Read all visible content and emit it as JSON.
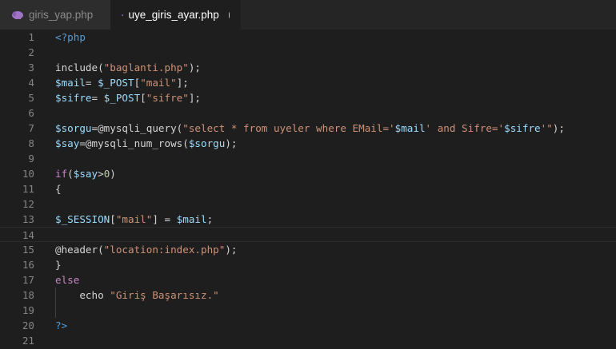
{
  "tabs": [
    {
      "label": "giris_yap.php",
      "icon": "php-elephant-icon",
      "active": false
    },
    {
      "label": "uye_giris_ayar.php",
      "icon": "php-elephant-icon",
      "active": true,
      "dirty": true
    }
  ],
  "colors": {
    "background": "#1e1e1e",
    "tab_bar": "#252526",
    "string": "#ce9178",
    "keyword": "#c586c0",
    "variable": "#9cdcfe",
    "tag": "#569cd6",
    "number": "#b5cea8",
    "line_number": "#858585",
    "php_icon": "#a074c4"
  },
  "editor": {
    "current_line": 14,
    "lines": [
      {
        "n": "1",
        "tokens": [
          {
            "t": "<?php",
            "c": "tag"
          }
        ]
      },
      {
        "n": "2",
        "tokens": []
      },
      {
        "n": "3",
        "tokens": [
          {
            "t": "include(",
            "c": "fn"
          },
          {
            "t": "\"baglanti.php\"",
            "c": "str"
          },
          {
            "t": ");",
            "c": "txt"
          }
        ]
      },
      {
        "n": "4",
        "tokens": [
          {
            "t": "$mail",
            "c": "var"
          },
          {
            "t": "= ",
            "c": "txt"
          },
          {
            "t": "$_POST",
            "c": "var"
          },
          {
            "t": "[",
            "c": "txt"
          },
          {
            "t": "\"mail\"",
            "c": "str"
          },
          {
            "t": "];",
            "c": "txt"
          }
        ]
      },
      {
        "n": "5",
        "tokens": [
          {
            "t": "$sifre",
            "c": "var"
          },
          {
            "t": "= ",
            "c": "txt"
          },
          {
            "t": "$_POST",
            "c": "var"
          },
          {
            "t": "[",
            "c": "txt"
          },
          {
            "t": "\"sifre\"",
            "c": "str"
          },
          {
            "t": "];",
            "c": "txt"
          }
        ]
      },
      {
        "n": "6",
        "tokens": []
      },
      {
        "n": "7",
        "tokens": [
          {
            "t": "$sorgu",
            "c": "var"
          },
          {
            "t": "=@mysqli_query(",
            "c": "txt"
          },
          {
            "t": "\"select * from uyeler where EMail='",
            "c": "str"
          },
          {
            "t": "$mail",
            "c": "var"
          },
          {
            "t": "' and Sifre='",
            "c": "str"
          },
          {
            "t": "$sifre",
            "c": "var"
          },
          {
            "t": "'\"",
            "c": "str"
          },
          {
            "t": ");",
            "c": "txt"
          }
        ]
      },
      {
        "n": "8",
        "tokens": [
          {
            "t": "$say",
            "c": "var"
          },
          {
            "t": "=@mysqli_num_rows(",
            "c": "txt"
          },
          {
            "t": "$sorgu",
            "c": "var"
          },
          {
            "t": ");",
            "c": "txt"
          }
        ]
      },
      {
        "n": "9",
        "tokens": []
      },
      {
        "n": "10",
        "tokens": [
          {
            "t": "if",
            "c": "kw"
          },
          {
            "t": "(",
            "c": "txt"
          },
          {
            "t": "$say",
            "c": "var"
          },
          {
            "t": ">",
            "c": "txt"
          },
          {
            "t": "0",
            "c": "num"
          },
          {
            "t": ")",
            "c": "txt"
          }
        ]
      },
      {
        "n": "11",
        "tokens": [
          {
            "t": "{",
            "c": "txt"
          }
        ]
      },
      {
        "n": "12",
        "tokens": []
      },
      {
        "n": "13",
        "tokens": [
          {
            "t": "$_SESSION",
            "c": "var"
          },
          {
            "t": "[",
            "c": "txt"
          },
          {
            "t": "\"mail\"",
            "c": "str"
          },
          {
            "t": "] = ",
            "c": "txt"
          },
          {
            "t": "$mail",
            "c": "var"
          },
          {
            "t": ";",
            "c": "txt"
          }
        ]
      },
      {
        "n": "14",
        "tokens": []
      },
      {
        "n": "15",
        "tokens": [
          {
            "t": "@header(",
            "c": "txt"
          },
          {
            "t": "\"location:index.php\"",
            "c": "str"
          },
          {
            "t": ");",
            "c": "txt"
          }
        ]
      },
      {
        "n": "16",
        "tokens": [
          {
            "t": "}",
            "c": "txt"
          }
        ]
      },
      {
        "n": "17",
        "tokens": [
          {
            "t": "else",
            "c": "kw"
          }
        ]
      },
      {
        "n": "18",
        "tokens": [
          {
            "t": "    echo ",
            "c": "txt"
          },
          {
            "t": "\"Giriş Başarısız.\"",
            "c": "str"
          }
        ]
      },
      {
        "n": "19",
        "tokens": []
      },
      {
        "n": "20",
        "tokens": [
          {
            "t": "?>",
            "c": "tag"
          }
        ]
      },
      {
        "n": "21",
        "tokens": []
      }
    ]
  }
}
